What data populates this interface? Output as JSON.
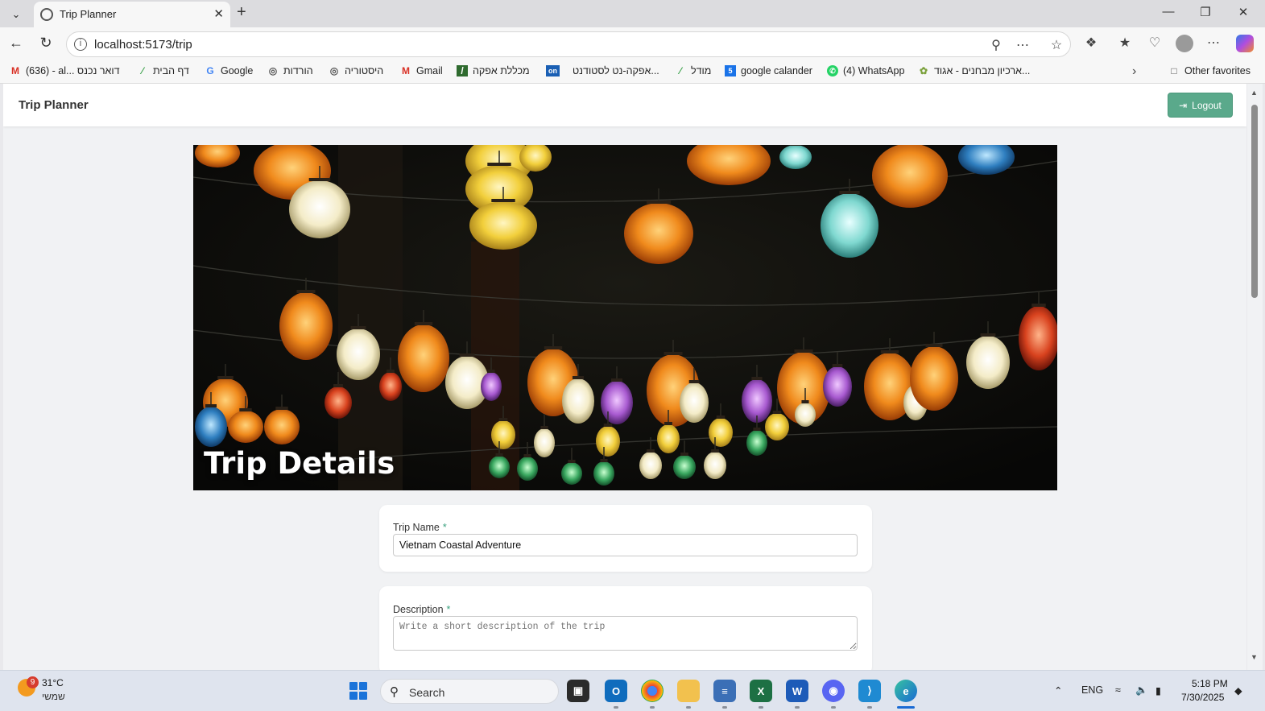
{
  "browser": {
    "tab_title": "Trip Planner",
    "url": "localhost:5173/trip",
    "other_favorites": "Other favorites",
    "bookmarks": [
      {
        "label": "(636) - al... דואר נכנס",
        "icon": "gmail-icon",
        "color": "#d93025"
      },
      {
        "label": "דף הבית",
        "icon": "moodle-leaf-icon",
        "color": "#3aa14a"
      },
      {
        "label": "Google",
        "icon": "google-icon",
        "color": "#4285f4"
      },
      {
        "label": "הורדות",
        "icon": "globe-icon",
        "color": "#555555"
      },
      {
        "label": "היסטוריה",
        "icon": "globe-icon",
        "color": "#555555"
      },
      {
        "label": "Gmail",
        "icon": "gmail-icon",
        "color": "#d93025"
      },
      {
        "label": "מכללת אפקה",
        "icon": "afeka-icon",
        "color": "#2f6b2f"
      },
      {
        "label": "",
        "icon": "on-icon",
        "color": "#1a5fb4"
      },
      {
        "label": "אפקה-נט לסטודנט...",
        "icon": "",
        "color": ""
      },
      {
        "label": "מודל",
        "icon": "moodle-leaf-icon",
        "color": "#3aa14a"
      },
      {
        "label": "google calander",
        "icon": "calendar-icon",
        "color": "#1a73e8"
      },
      {
        "label": "(4) WhatsApp",
        "icon": "whatsapp-icon",
        "color": "#25d366"
      },
      {
        "label": "ארכיון מבחנים - אגוד...",
        "icon": "archive-icon",
        "color": "#7aa03a"
      }
    ]
  },
  "app": {
    "brand": "Trip Planner",
    "logout_label": "Logout",
    "hero_title": "Trip Details",
    "trip_name_label": "Trip Name",
    "trip_name_value": "Vietnam Coastal Adventure",
    "description_label": "Description",
    "description_placeholder": "Write a short description of the trip",
    "required_mark": "*",
    "accent_color": "#5aa98b"
  },
  "taskbar": {
    "temperature": "31°C",
    "weather_desc": "שמשי",
    "weather_badge": "9",
    "search_label": "Search",
    "language": "ENG",
    "time": "5:18 PM",
    "date": "7/30/2025"
  }
}
